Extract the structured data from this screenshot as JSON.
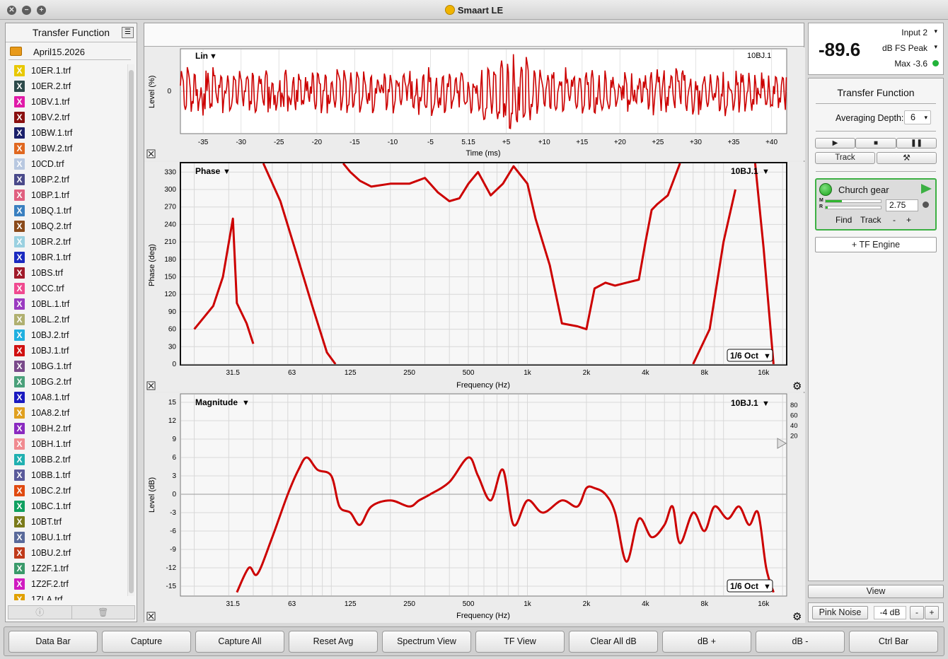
{
  "window": {
    "title": "Smaart LE"
  },
  "sidebar": {
    "title": "Transfer Function",
    "folder": "April15.2026",
    "files": [
      {
        "name": "10ER.1.trf",
        "color": "#e8c800"
      },
      {
        "name": "10ER.2.trf",
        "color": "#2d4a4a"
      },
      {
        "name": "10BV.1.trf",
        "color": "#e01aa8"
      },
      {
        "name": "10BV.2.trf",
        "color": "#8a1010"
      },
      {
        "name": "10BW.1.trf",
        "color": "#1a1f6a"
      },
      {
        "name": "10BW.2.trf",
        "color": "#e06820"
      },
      {
        "name": "10CD.trf",
        "color": "#b8c8e0"
      },
      {
        "name": "10BP.2.trf",
        "color": "#4a4a8a"
      },
      {
        "name": "10BP.1.trf",
        "color": "#e06080"
      },
      {
        "name": "10BQ.1.trf",
        "color": "#3a80c0"
      },
      {
        "name": "10BQ.2.trf",
        "color": "#8a4a1a"
      },
      {
        "name": "10BR.2.trf",
        "color": "#9ad0e0"
      },
      {
        "name": "10BR.1.trf",
        "color": "#1a2ac0"
      },
      {
        "name": "10BS.trf",
        "color": "#a01a2a"
      },
      {
        "name": "10CC.trf",
        "color": "#f04a90"
      },
      {
        "name": "10BL.1.trf",
        "color": "#9a3ac0"
      },
      {
        "name": "10BL.2.trf",
        "color": "#b0b070"
      },
      {
        "name": "10BJ.2.trf",
        "color": "#20b0e0"
      },
      {
        "name": "10BJ.1.trf",
        "color": "#d01010"
      },
      {
        "name": "10BG.1.trf",
        "color": "#7a4a8a"
      },
      {
        "name": "10BG.2.trf",
        "color": "#4aa07a"
      },
      {
        "name": "10A8.1.trf",
        "color": "#1a1ac0"
      },
      {
        "name": "10A8.2.trf",
        "color": "#e0a020"
      },
      {
        "name": "10BH.2.trf",
        "color": "#8a2ac0"
      },
      {
        "name": "10BH.1.trf",
        "color": "#f08a90"
      },
      {
        "name": "10BB.2.trf",
        "color": "#20b0b0"
      },
      {
        "name": "10BB.1.trf",
        "color": "#5a5a9a"
      },
      {
        "name": "10BC.2.trf",
        "color": "#e04a10"
      },
      {
        "name": "10BC.1.trf",
        "color": "#10a060"
      },
      {
        "name": "10BT.trf",
        "color": "#7a7a1a"
      },
      {
        "name": "10BU.1.trf",
        "color": "#5a6a9a"
      },
      {
        "name": "10BU.2.trf",
        "color": "#c03a1a"
      },
      {
        "name": "1Z2F.1.trf",
        "color": "#3a9a6a"
      },
      {
        "name": "1Z2F.2.trf",
        "color": "#d01ac0"
      },
      {
        "name": "1ZLA.trf",
        "color": "#e0a000"
      }
    ]
  },
  "impulse": {
    "mode": "Lin",
    "trace": "10BJ.1",
    "ylabel": "Level (%)",
    "xlabel": "Time (ms)",
    "yzero": "0",
    "ticks": [
      "-35",
      "-30",
      "-25",
      "-20",
      "-15",
      "-10",
      "-5",
      "5.15",
      "+5",
      "+10",
      "+15",
      "+20",
      "+25",
      "+30",
      "+35",
      "+40"
    ]
  },
  "phase": {
    "title": "Phase",
    "trace": "10BJ.1",
    "ylabel": "Phase (deg)",
    "xlabel": "Frequency (Hz)",
    "smoothing": "1/6 Oct",
    "yticks": [
      "0",
      "30",
      "60",
      "90",
      "120",
      "150",
      "180",
      "210",
      "240",
      "270",
      "300",
      "330"
    ]
  },
  "magnitude": {
    "title": "Magnitude",
    "trace": "10BJ.1",
    "ylabel": "Level (dB)",
    "xlabel": "Frequency (Hz)",
    "smoothing": "1/6 Oct",
    "yticks": [
      "15",
      "12",
      "9",
      "6",
      "3",
      "0",
      "-3",
      "-6",
      "-9",
      "-12",
      "-15"
    ],
    "coh_ticks": [
      "80",
      "60",
      "40",
      "20"
    ]
  },
  "freq_ticks": [
    "31.5",
    "63",
    "125",
    "250",
    "500",
    "1k",
    "2k",
    "4k",
    "8k",
    "16k"
  ],
  "meter": {
    "value": "-89.6",
    "input": "Input 2",
    "mode": "dB FS Peak",
    "max": "Max -3.6"
  },
  "tf": {
    "title": "Transfer Function",
    "avg_label": "Averaging Depth:",
    "avg_value": "6",
    "track": "Track",
    "engine": {
      "name": "Church gear",
      "delay": "2.75",
      "find": "Find",
      "track": "Track",
      "minus": "-",
      "plus": "+"
    },
    "add_engine": "+ TF Engine"
  },
  "view_label": "View",
  "generator": {
    "label": "Pink Noise",
    "level": "-4 dB",
    "minus": "-",
    "plus": "+"
  },
  "bottom": [
    "Data Bar",
    "Capture",
    "Capture All",
    "Reset Avg",
    "Spectrum View",
    "TF View",
    "Clear All dB",
    "dB +",
    "dB -",
    "Ctrl Bar"
  ],
  "chart_data": [
    {
      "type": "line",
      "title": "Lin",
      "xlabel": "Time (ms)",
      "ylabel": "Level (%)",
      "xlim": [
        -38,
        42
      ],
      "series": [
        {
          "name": "10BJ.1",
          "color": "#cc0000"
        }
      ],
      "x": [
        -38,
        -35,
        -30,
        -25,
        -20,
        -15,
        -10,
        -5,
        0,
        3,
        5.15,
        8,
        10,
        15,
        20,
        25,
        30,
        35,
        40,
        42
      ],
      "y": [
        0.6,
        -0.6,
        0.5,
        -0.6,
        0.6,
        -0.5,
        0.6,
        -0.6,
        0.5,
        0.9,
        -1,
        0.8,
        0.6,
        -0.6,
        0.5,
        -0.6,
        0.6,
        -0.6,
        0.5,
        -0.6
      ]
    },
    {
      "type": "line",
      "title": "Phase",
      "xlabel": "Frequency (Hz)",
      "ylabel": "Phase (deg)",
      "ylim": [
        0,
        345
      ],
      "x_scale": "log",
      "series": [
        {
          "name": "10BJ.1",
          "color": "#cc0000"
        }
      ],
      "x": [
        20,
        25,
        28,
        31.5,
        33,
        37,
        40,
        45,
        55,
        65,
        80,
        95,
        105,
        115,
        125,
        140,
        160,
        200,
        250,
        300,
        350,
        400,
        450,
        500,
        560,
        650,
        750,
        850,
        1000,
        1100,
        1300,
        1500,
        1800,
        2000,
        2200,
        2500,
        2800,
        3200,
        3700,
        4000,
        4300,
        4600,
        5200,
        6000,
        7000,
        8500,
        10000,
        11500,
        13000,
        14500,
        16000,
        18000
      ],
      "y": [
        60,
        100,
        150,
        250,
        105,
        70,
        35,
        345,
        280,
        200,
        100,
        20,
        0,
        345,
        330,
        315,
        305,
        310,
        310,
        320,
        295,
        280,
        285,
        310,
        330,
        290,
        310,
        340,
        310,
        250,
        170,
        70,
        65,
        60,
        130,
        140,
        135,
        140,
        145,
        210,
        265,
        275,
        290,
        345,
        0,
        60,
        210,
        300,
        0,
        345,
        200,
        0
      ]
    },
    {
      "type": "line",
      "title": "Magnitude",
      "xlabel": "Frequency (Hz)",
      "ylabel": "Level (dB)",
      "ylim": [
        -16,
        16
      ],
      "x_scale": "log",
      "series": [
        {
          "name": "10BJ.1",
          "color": "#cc0000"
        }
      ],
      "x": [
        33,
        38,
        42,
        50,
        60,
        68,
        75,
        85,
        100,
        110,
        125,
        140,
        160,
        200,
        250,
        280,
        320,
        400,
        500,
        560,
        650,
        750,
        850,
        1000,
        1200,
        1500,
        1800,
        2000,
        2200,
        2500,
        2800,
        3200,
        3700,
        4300,
        5000,
        5500,
        6000,
        7000,
        8000,
        9000,
        10500,
        12000,
        13500,
        15000,
        16500,
        18000
      ],
      "y": [
        -16,
        -12,
        -13,
        -7,
        0,
        4,
        6,
        4,
        3,
        -2,
        -3,
        -5,
        -2,
        -1,
        -2,
        -1,
        0,
        2,
        6,
        3,
        -1,
        4,
        -5,
        -1,
        -3,
        -1,
        -2,
        1,
        1,
        0,
        -3,
        -11,
        -4,
        -7,
        -5,
        -2,
        -8,
        -3,
        -6,
        -2,
        -4,
        -2,
        -5,
        -3,
        -12,
        -16
      ]
    }
  ]
}
